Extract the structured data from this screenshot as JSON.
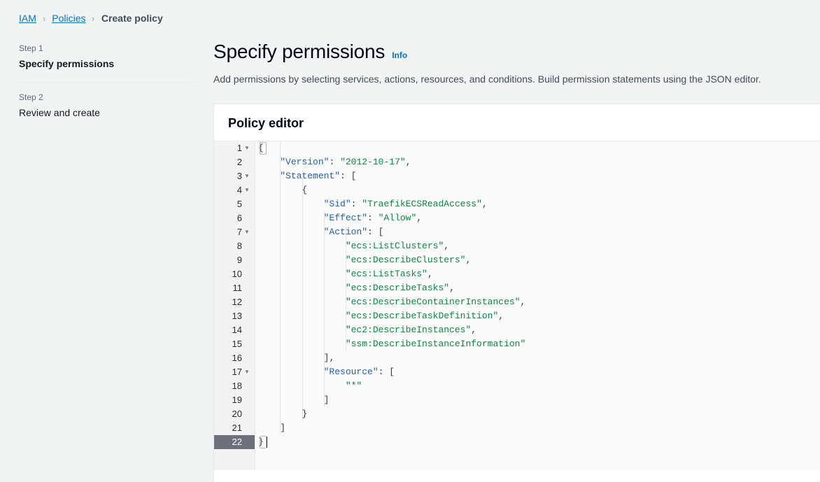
{
  "breadcrumb": {
    "items": [
      {
        "label": "IAM",
        "type": "link"
      },
      {
        "label": "Policies",
        "type": "link"
      },
      {
        "label": "Create policy",
        "type": "current"
      }
    ],
    "separator": "›"
  },
  "sidebar": {
    "steps": [
      {
        "step_label": "Step 1",
        "title": "Specify permissions",
        "active": true
      },
      {
        "step_label": "Step 2",
        "title": "Review and create",
        "active": false
      }
    ]
  },
  "main": {
    "title": "Specify permissions",
    "info_link": "Info",
    "description": "Add permissions by selecting services, actions, resources, and conditions. Build permission statements using the JSON editor."
  },
  "policy_editor": {
    "card_title": "Policy editor",
    "active_line": 22,
    "fold_lines": [
      1,
      3,
      4,
      7,
      17
    ],
    "lines": [
      {
        "n": 1,
        "text": "{"
      },
      {
        "n": 2,
        "text": "    \"Version\": \"2012-10-17\","
      },
      {
        "n": 3,
        "text": "    \"Statement\": ["
      },
      {
        "n": 4,
        "text": "        {"
      },
      {
        "n": 5,
        "text": "            \"Sid\": \"TraefikECSReadAccess\","
      },
      {
        "n": 6,
        "text": "            \"Effect\": \"Allow\","
      },
      {
        "n": 7,
        "text": "            \"Action\": ["
      },
      {
        "n": 8,
        "text": "                \"ecs:ListClusters\","
      },
      {
        "n": 9,
        "text": "                \"ecs:DescribeClusters\","
      },
      {
        "n": 10,
        "text": "                \"ecs:ListTasks\","
      },
      {
        "n": 11,
        "text": "                \"ecs:DescribeTasks\","
      },
      {
        "n": 12,
        "text": "                \"ecs:DescribeContainerInstances\","
      },
      {
        "n": 13,
        "text": "                \"ecs:DescribeTaskDefinition\","
      },
      {
        "n": 14,
        "text": "                \"ec2:DescribeInstances\","
      },
      {
        "n": 15,
        "text": "                \"ssm:DescribeInstanceInformation\""
      },
      {
        "n": 16,
        "text": "            ],"
      },
      {
        "n": 17,
        "text": "            \"Resource\": ["
      },
      {
        "n": 18,
        "text": "                \"*\""
      },
      {
        "n": 19,
        "text": "            ]"
      },
      {
        "n": 20,
        "text": "        }"
      },
      {
        "n": 21,
        "text": "    ]"
      },
      {
        "n": 22,
        "text": "}"
      }
    ],
    "policy_document": {
      "Version": "2012-10-17",
      "Statement": [
        {
          "Sid": "TraefikECSReadAccess",
          "Effect": "Allow",
          "Action": [
            "ecs:ListClusters",
            "ecs:DescribeClusters",
            "ecs:ListTasks",
            "ecs:DescribeTasks",
            "ecs:DescribeContainerInstances",
            "ecs:DescribeTaskDefinition",
            "ec2:DescribeInstances",
            "ssm:DescribeInstanceInformation"
          ],
          "Resource": [
            "*"
          ]
        }
      ]
    }
  },
  "colors": {
    "link": "#0972d3",
    "page_bg": "#f2f3f3",
    "card_bg": "#ffffff",
    "editor_bg": "#fafafa",
    "gutter_bg": "#f3f3f3",
    "active_line_gutter": "#6d717b",
    "json_key": "#2a5db0",
    "json_string": "#108548"
  }
}
